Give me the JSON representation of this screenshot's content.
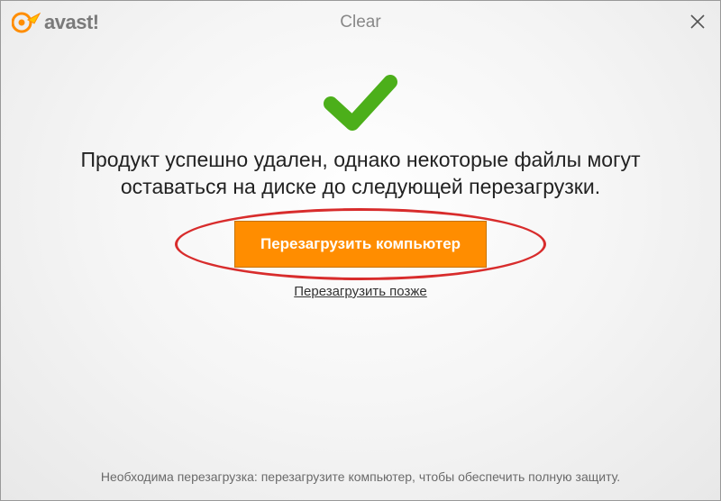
{
  "header": {
    "brand": "avast!",
    "title": "Clear"
  },
  "main": {
    "message": "Продукт успешно удален, однако некоторые файлы могут оставаться на диске до следующей перезагрузки.",
    "restart_button": "Перезагрузить компьютер",
    "later_link": "Перезагрузить позже"
  },
  "footer": {
    "text": "Необходима перезагрузка: перезагрузите компьютер, чтобы обеспечить полную защиту."
  },
  "colors": {
    "accent_orange": "#ff8d00",
    "success_green": "#4caf1a",
    "annotation_red": "#d82c2c"
  }
}
